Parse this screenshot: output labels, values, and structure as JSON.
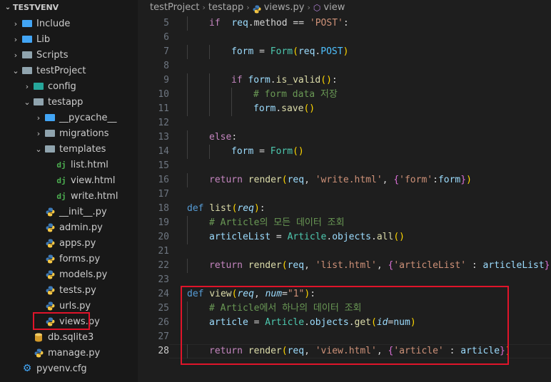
{
  "explorer": {
    "root_label": "TESTVENV",
    "items": [
      {
        "label": "Include",
        "type": "folder",
        "icon": "include-folder-icon",
        "collapsed": true,
        "depth": 0
      },
      {
        "label": "Lib",
        "type": "folder",
        "icon": "lib-folder-icon",
        "collapsed": true,
        "depth": 0
      },
      {
        "label": "Scripts",
        "type": "folder",
        "icon": "scripts-folder-icon",
        "collapsed": true,
        "depth": 0
      },
      {
        "label": "testProject",
        "type": "folder",
        "icon": "folder-icon",
        "collapsed": false,
        "depth": 0
      },
      {
        "label": "config",
        "type": "folder",
        "icon": "config-folder-icon",
        "collapsed": true,
        "depth": 1
      },
      {
        "label": "testapp",
        "type": "folder",
        "icon": "folder-icon",
        "collapsed": false,
        "depth": 1
      },
      {
        "label": "__pycache__",
        "type": "folder",
        "icon": "pycache-folder-icon",
        "collapsed": true,
        "depth": 2
      },
      {
        "label": "migrations",
        "type": "folder",
        "icon": "folder-icon",
        "collapsed": true,
        "depth": 2
      },
      {
        "label": "templates",
        "type": "folder",
        "icon": "folder-icon",
        "collapsed": false,
        "depth": 2
      },
      {
        "label": "list.html",
        "type": "file",
        "icon": "django-icon",
        "depth": 3
      },
      {
        "label": "view.html",
        "type": "file",
        "icon": "django-icon",
        "depth": 3
      },
      {
        "label": "write.html",
        "type": "file",
        "icon": "django-icon",
        "depth": 3
      },
      {
        "label": "__init__.py",
        "type": "file",
        "icon": "python-icon",
        "depth": 2
      },
      {
        "label": "admin.py",
        "type": "file",
        "icon": "python-icon",
        "depth": 2
      },
      {
        "label": "apps.py",
        "type": "file",
        "icon": "python-icon",
        "depth": 2
      },
      {
        "label": "forms.py",
        "type": "file",
        "icon": "python-icon",
        "depth": 2
      },
      {
        "label": "models.py",
        "type": "file",
        "icon": "python-icon",
        "depth": 2
      },
      {
        "label": "tests.py",
        "type": "file",
        "icon": "python-icon",
        "depth": 2
      },
      {
        "label": "urls.py",
        "type": "file",
        "icon": "python-icon",
        "depth": 2
      },
      {
        "label": "views.py",
        "type": "file",
        "icon": "python-icon",
        "depth": 2,
        "highlighted": true
      },
      {
        "label": "db.sqlite3",
        "type": "file",
        "icon": "database-icon",
        "depth": 1
      },
      {
        "label": "manage.py",
        "type": "file",
        "icon": "python-icon",
        "depth": 1
      },
      {
        "label": "pyvenv.cfg",
        "type": "file",
        "icon": "gear-icon",
        "depth": 0
      }
    ]
  },
  "breadcrumb": {
    "parts": [
      "testProject",
      "testapp",
      "views.py",
      "view"
    ]
  },
  "editor": {
    "current_line": 28,
    "lines": [
      {
        "n": "5",
        "indent": 1,
        "tokens": [
          [
            "kw",
            "if"
          ],
          [
            "",
            "  "
          ],
          [
            "var",
            "req"
          ],
          [
            "",
            ".method == "
          ],
          [
            "str",
            "'POST'"
          ],
          [
            "",
            ":"
          ]
        ]
      },
      {
        "n": "6",
        "indent": 0,
        "tokens": []
      },
      {
        "n": "7",
        "indent": 2,
        "tokens": [
          [
            "var",
            "form"
          ],
          [
            "",
            " = "
          ],
          [
            "cls",
            "Form"
          ],
          [
            "br1",
            "("
          ],
          [
            "var",
            "req"
          ],
          [
            "",
            "."
          ],
          [
            "const",
            "POST"
          ],
          [
            "br1",
            ")"
          ]
        ]
      },
      {
        "n": "8",
        "indent": 0,
        "tokens": []
      },
      {
        "n": "9",
        "indent": 2,
        "tokens": [
          [
            "kw",
            "if"
          ],
          [
            "",
            " "
          ],
          [
            "var",
            "form"
          ],
          [
            "",
            "."
          ],
          [
            "fn",
            "is_valid"
          ],
          [
            "br1",
            "()"
          ],
          [
            "",
            ":"
          ]
        ]
      },
      {
        "n": "10",
        "indent": 3,
        "tokens": [
          [
            "cmt",
            "# form data 저장"
          ]
        ]
      },
      {
        "n": "11",
        "indent": 3,
        "tokens": [
          [
            "var",
            "form"
          ],
          [
            "",
            "."
          ],
          [
            "fn",
            "save"
          ],
          [
            "br1",
            "()"
          ]
        ]
      },
      {
        "n": "12",
        "indent": 0,
        "tokens": []
      },
      {
        "n": "13",
        "indent": 1,
        "tokens": [
          [
            "kw",
            "else"
          ],
          [
            "",
            ":"
          ]
        ]
      },
      {
        "n": "14",
        "indent": 2,
        "tokens": [
          [
            "var",
            "form"
          ],
          [
            "",
            " = "
          ],
          [
            "cls",
            "Form"
          ],
          [
            "br1",
            "()"
          ]
        ]
      },
      {
        "n": "15",
        "indent": 0,
        "tokens": []
      },
      {
        "n": "16",
        "indent": 1,
        "tokens": [
          [
            "kw",
            "return"
          ],
          [
            "",
            " "
          ],
          [
            "fn",
            "render"
          ],
          [
            "br1",
            "("
          ],
          [
            "var",
            "req"
          ],
          [
            "",
            ", "
          ],
          [
            "str",
            "'write.html'"
          ],
          [
            "",
            ", "
          ],
          [
            "br2",
            "{"
          ],
          [
            "str",
            "'form'"
          ],
          [
            "",
            ":"
          ],
          [
            "var",
            "form"
          ],
          [
            "br2",
            "}"
          ],
          [
            "br1",
            ")"
          ]
        ]
      },
      {
        "n": "17",
        "indent": 0,
        "tokens": []
      },
      {
        "n": "18",
        "indent": 0,
        "tokens": [
          [
            "def",
            "def"
          ],
          [
            "",
            " "
          ],
          [
            "fn",
            "list"
          ],
          [
            "br1",
            "("
          ],
          [
            "prm",
            "req"
          ],
          [
            "br1",
            ")"
          ],
          [
            "",
            ":"
          ]
        ]
      },
      {
        "n": "19",
        "indent": 1,
        "tokens": [
          [
            "cmt",
            "# Article의 모든 데이터 조회"
          ]
        ]
      },
      {
        "n": "20",
        "indent": 1,
        "tokens": [
          [
            "var",
            "articleList"
          ],
          [
            "",
            " = "
          ],
          [
            "cls",
            "Article"
          ],
          [
            "",
            "."
          ],
          [
            "var",
            "objects"
          ],
          [
            "",
            "."
          ],
          [
            "fn",
            "all"
          ],
          [
            "br1",
            "()"
          ]
        ]
      },
      {
        "n": "21",
        "indent": 0,
        "tokens": []
      },
      {
        "n": "22",
        "indent": 1,
        "tokens": [
          [
            "kw",
            "return"
          ],
          [
            "",
            " "
          ],
          [
            "fn",
            "render"
          ],
          [
            "br1",
            "("
          ],
          [
            "var",
            "req"
          ],
          [
            "",
            ", "
          ],
          [
            "str",
            "'list.html'"
          ],
          [
            "",
            ", "
          ],
          [
            "br2",
            "{"
          ],
          [
            "str",
            "'articleList'"
          ],
          [
            "",
            " : "
          ],
          [
            "var",
            "articleList"
          ],
          [
            "br2",
            "}"
          ],
          [
            "br1",
            ")"
          ]
        ]
      },
      {
        "n": "23",
        "indent": 0,
        "tokens": []
      },
      {
        "n": "24",
        "indent": 0,
        "tokens": [
          [
            "def",
            "def"
          ],
          [
            "",
            " "
          ],
          [
            "fn",
            "view"
          ],
          [
            "br1",
            "("
          ],
          [
            "prm",
            "req"
          ],
          [
            "",
            ", "
          ],
          [
            "prm",
            "num"
          ],
          [
            "",
            "="
          ],
          [
            "str",
            "\"1\""
          ],
          [
            "br1",
            ")"
          ],
          [
            "",
            ":"
          ]
        ]
      },
      {
        "n": "25",
        "indent": 1,
        "tokens": [
          [
            "cmt",
            "# Article에서 하나의 데이터 조회"
          ]
        ]
      },
      {
        "n": "26",
        "indent": 1,
        "tokens": [
          [
            "var",
            "article"
          ],
          [
            "",
            " = "
          ],
          [
            "cls",
            "Article"
          ],
          [
            "",
            "."
          ],
          [
            "var",
            "objects"
          ],
          [
            "",
            "."
          ],
          [
            "fn",
            "get"
          ],
          [
            "br1",
            "("
          ],
          [
            "prm",
            "id"
          ],
          [
            "",
            "="
          ],
          [
            "var",
            "num"
          ],
          [
            "br1",
            ")"
          ]
        ]
      },
      {
        "n": "27",
        "indent": 0,
        "tokens": []
      },
      {
        "n": "28",
        "indent": 1,
        "tokens": [
          [
            "kw",
            "return"
          ],
          [
            "",
            " "
          ],
          [
            "fn",
            "render"
          ],
          [
            "br1",
            "("
          ],
          [
            "var",
            "req"
          ],
          [
            "",
            ", "
          ],
          [
            "str",
            "'view.html'"
          ],
          [
            "",
            ", "
          ],
          [
            "br2",
            "{"
          ],
          [
            "str",
            "'article'"
          ],
          [
            "",
            " : "
          ],
          [
            "var",
            "article"
          ],
          [
            "br2",
            "}"
          ],
          [
            "br1",
            ")"
          ]
        ]
      }
    ]
  },
  "colors": {
    "highlight_border": "#e0142a",
    "background": "#1e1e1e",
    "sidebar": "#181818"
  }
}
